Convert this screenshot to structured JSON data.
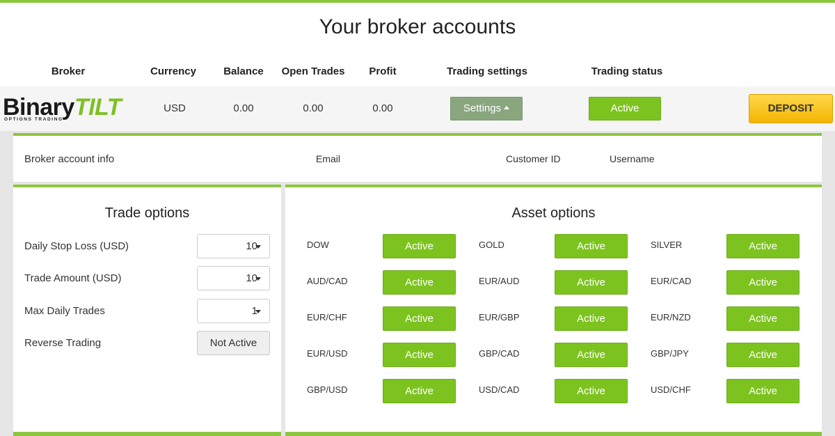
{
  "title": "Your broker accounts",
  "columns": {
    "broker": "Broker",
    "currency": "Currency",
    "balance": "Balance",
    "open_trades": "Open Trades",
    "profit": "Profit",
    "trading_settings": "Trading settings",
    "trading_status": "Trading status"
  },
  "account": {
    "logo_main_part1": "Binary",
    "logo_main_part2": "TILT",
    "logo_sub": "OPTIONS TRADING",
    "currency": "USD",
    "balance": "0.00",
    "open_trades": "0.00",
    "profit": "0.00",
    "settings_label": "Settings",
    "status_label": "Active",
    "deposit_label": "DEPOSIT"
  },
  "info": {
    "title": "Broker account info",
    "email": "Email",
    "customer_id": "Customer ID",
    "username": "Username"
  },
  "trade_options": {
    "title": "Trade options",
    "daily_stop_loss_label": "Daily Stop Loss (USD)",
    "daily_stop_loss_value": "10",
    "trade_amount_label": "Trade Amount (USD)",
    "trade_amount_value": "10",
    "max_daily_trades_label": "Max Daily Trades",
    "max_daily_trades_value": "1",
    "reverse_trading_label": "Reverse Trading",
    "reverse_trading_value": "Not Active"
  },
  "asset_options": {
    "title": "Asset options",
    "assets": [
      {
        "name": "DOW",
        "status": "Active"
      },
      {
        "name": "GOLD",
        "status": "Active"
      },
      {
        "name": "SILVER",
        "status": "Active"
      },
      {
        "name": "AUD/CAD",
        "status": "Active"
      },
      {
        "name": "EUR/AUD",
        "status": "Active"
      },
      {
        "name": "EUR/CAD",
        "status": "Active"
      },
      {
        "name": "EUR/CHF",
        "status": "Active"
      },
      {
        "name": "EUR/GBP",
        "status": "Active"
      },
      {
        "name": "EUR/NZD",
        "status": "Active"
      },
      {
        "name": "EUR/USD",
        "status": "Active"
      },
      {
        "name": "GBP/CAD",
        "status": "Active"
      },
      {
        "name": "GBP/JPY",
        "status": "Active"
      },
      {
        "name": "GBP/USD",
        "status": "Active"
      },
      {
        "name": "USD/CAD",
        "status": "Active"
      },
      {
        "name": "USD/CHF",
        "status": "Active"
      }
    ]
  },
  "colors": {
    "accent_green": "#8cc63f",
    "active_button": "#7dc31f",
    "settings_button": "#8aa67f",
    "deposit_button": "#f3b500"
  }
}
